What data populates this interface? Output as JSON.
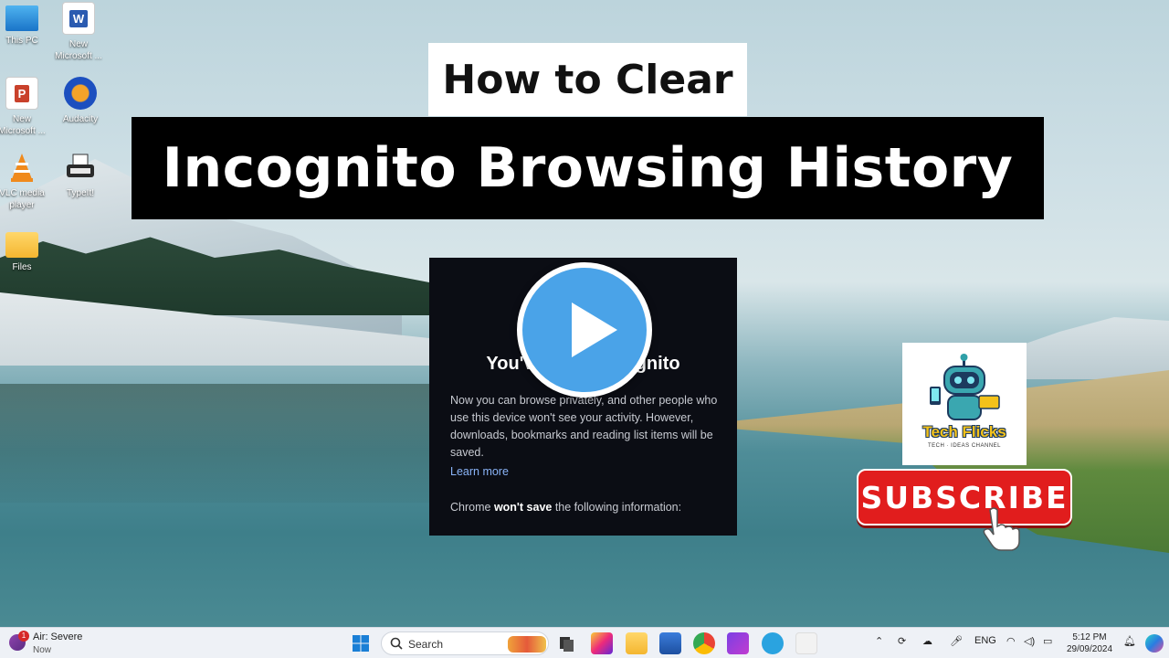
{
  "desktop_icons": [
    {
      "label": "This PC",
      "icon": "monitor-icon"
    },
    {
      "label": "New Microsoft ...",
      "icon": "word-icon"
    },
    {
      "label": "New Microsoft ...",
      "icon": "powerpoint-icon"
    },
    {
      "label": "Audacity",
      "icon": "audacity-icon"
    },
    {
      "label": "VLC media player",
      "icon": "vlc-icon"
    },
    {
      "label": "TypeIt!",
      "icon": "typewriter-icon"
    },
    {
      "label": "Files",
      "icon": "folder-icon"
    }
  ],
  "title": {
    "line1": "How to Clear",
    "line2": "Incognito Browsing History"
  },
  "incognito_panel": {
    "heading": "You've gone Incognito",
    "body": "Now you can browse privately, and other people who use this device won't see your activity. However, downloads, bookmarks and reading list items will be saved.",
    "link": "Learn more",
    "footer_prefix": "Chrome ",
    "footer_bold": "won't save",
    "footer_suffix": " the following information:"
  },
  "logo": {
    "name": "Tech Flicks",
    "tagline": "TECH · IDEAS CHANNEL"
  },
  "subscribe_label": "SUBSCRIBE",
  "taskbar": {
    "weather_title": "Air: Severe",
    "weather_sub": "Now",
    "weather_badge": "1",
    "search_placeholder": "Search",
    "language": "ENG",
    "time": "5:12 PM",
    "date": "29/09/2024"
  },
  "colors": {
    "play_button": "#4aa3e8",
    "subscribe": "#e11d1d",
    "link": "#8ab4f8"
  }
}
